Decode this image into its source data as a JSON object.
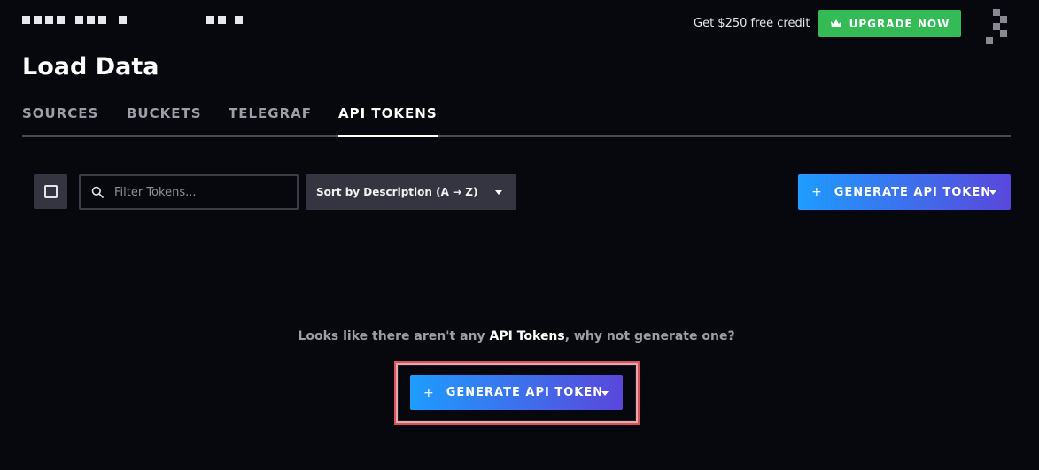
{
  "header": {
    "credit_text": "Get $250 free credit",
    "upgrade_label": "UPGRADE NOW",
    "upgrade_color": "#34bb55"
  },
  "page": {
    "title": "Load Data"
  },
  "tabs": [
    {
      "label": "SOURCES",
      "active": false
    },
    {
      "label": "BUCKETS",
      "active": false
    },
    {
      "label": "TELEGRAF",
      "active": false
    },
    {
      "label": "API TOKENS",
      "active": true
    }
  ],
  "toolbar": {
    "search_placeholder": "Filter Tokens...",
    "search_value": "",
    "sort_label": "Sort by Description (A → Z)",
    "generate_label": "GENERATE API TOKEN"
  },
  "empty_state": {
    "text_before": "Looks like there aren't any ",
    "text_strong": "API Tokens",
    "text_after": ", why not generate one?",
    "generate_label": "GENERATE API TOKEN"
  },
  "icons": {
    "upgrade": "crown-icon",
    "search": "search-icon",
    "plus": "plus-icon",
    "dropdown": "caret-down-icon"
  },
  "colors": {
    "background": "#07070e",
    "button_gradient_start": "#1e9cff",
    "button_gradient_end": "#5a47db",
    "highlight_border": "#d9535a"
  }
}
